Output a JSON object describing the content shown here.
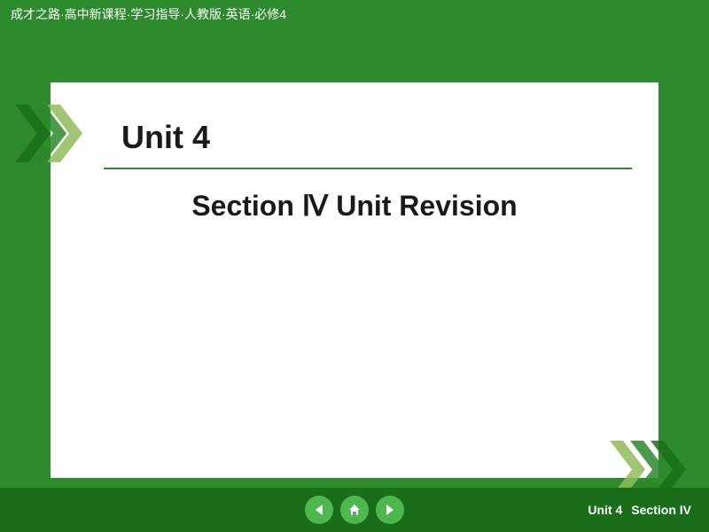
{
  "header": {
    "title": "成才之路·高中新课程·学习指导·人教版·英语·必修4"
  },
  "slide": {
    "unit_label": "Unit 4",
    "section_label": "Section Ⅳ    Unit Revision"
  },
  "bottom": {
    "unit": "Unit 4",
    "section": "Section IV",
    "nav": {
      "prev_label": "←",
      "home_label": "⌂",
      "next_label": "→"
    }
  },
  "colors": {
    "green": "#2d8a2d",
    "dark_green": "#1a6e1a",
    "light_green": "#4db84d",
    "olive_green": "#8fbc5a"
  }
}
